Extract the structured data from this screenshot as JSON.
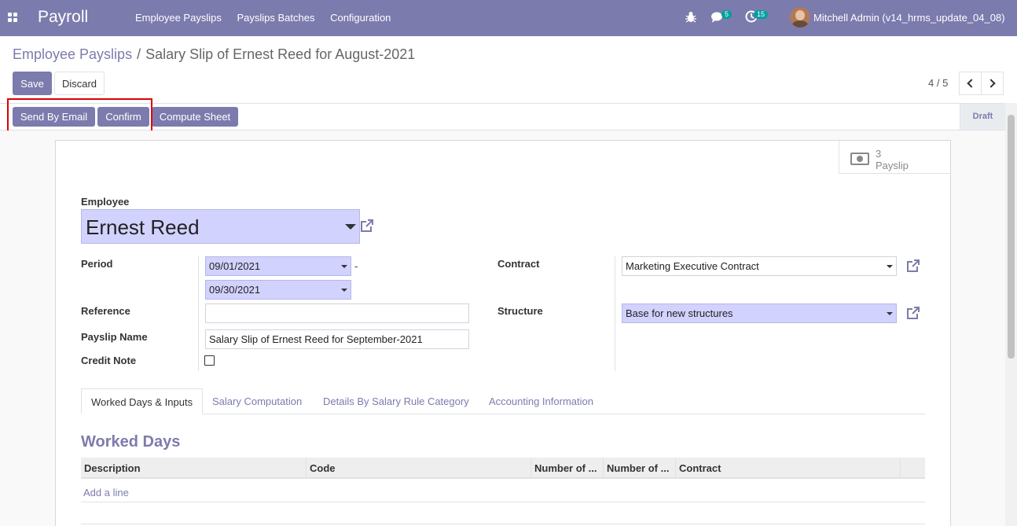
{
  "navbar": {
    "app_name": "Payroll",
    "menu": [
      "Employee Payslips",
      "Payslips Batches",
      "Configuration"
    ],
    "messages_badge": "5",
    "activities_badge": "15",
    "user": "Mitchell Admin (v14_hrms_update_04_08)",
    "color": "#7c7bad"
  },
  "breadcrumb": {
    "parent": "Employee Payslips",
    "separator": "/",
    "current": "Salary Slip of Ernest Reed for August-2021"
  },
  "actions": {
    "save": "Save",
    "discard": "Discard"
  },
  "pager": {
    "value": "4 / 5"
  },
  "header_buttons": {
    "send_email": "Send By Email",
    "confirm": "Confirm",
    "compute": "Compute Sheet"
  },
  "status": {
    "current": "Draft"
  },
  "smart_button": {
    "count": "3",
    "label": "Payslip"
  },
  "form": {
    "employee_label": "Employee",
    "employee": "Ernest Reed",
    "period_label": "Period",
    "date_from": "09/01/2021",
    "date_sep": "-",
    "date_to": "09/30/2021",
    "reference_label": "Reference",
    "reference": "",
    "payslip_name_label": "Payslip Name",
    "payslip_name": "Salary Slip of Ernest Reed for September-2021",
    "credit_note_label": "Credit Note",
    "credit_note": false,
    "contract_label": "Contract",
    "contract": "Marketing Executive Contract",
    "structure_label": "Structure",
    "structure": "Base for new structures"
  },
  "tabs": [
    "Worked Days & Inputs",
    "Salary Computation",
    "Details By Salary Rule Category",
    "Accounting Information"
  ],
  "worked_days": {
    "title": "Worked Days",
    "columns": [
      "Description",
      "Code",
      "Number of ...",
      "Number of ...",
      "Contract"
    ],
    "add_line": "Add a line"
  }
}
